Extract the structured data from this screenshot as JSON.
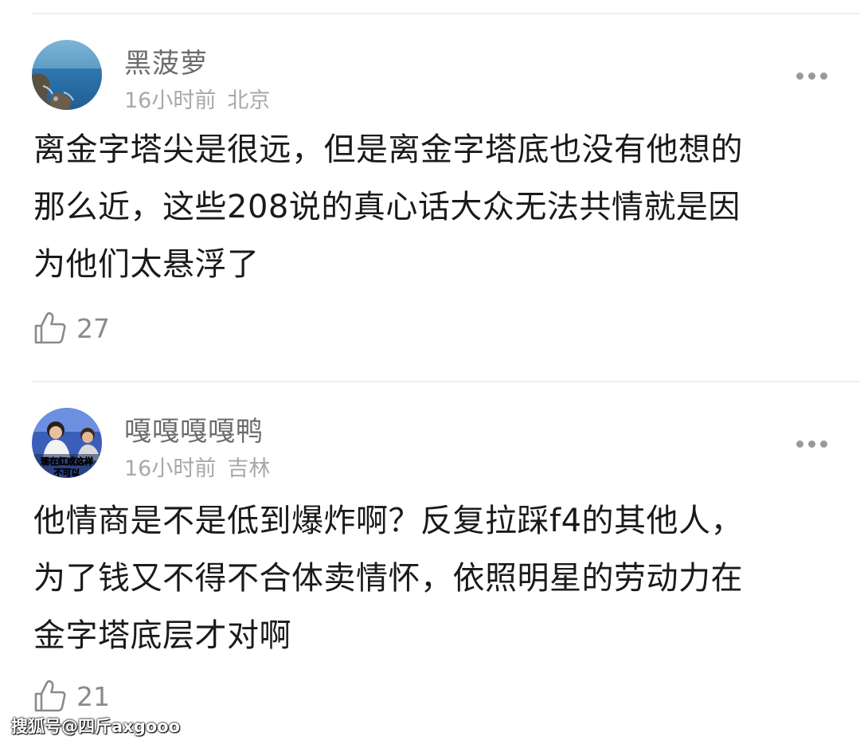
{
  "comments": [
    {
      "username": "黑菠萝",
      "time": "16小时前",
      "location": "北京",
      "avatar_icon": "sea-coast-photo",
      "content_lines": [
        "离金字塔尖是很远，但是离金字塔底也没有他想的",
        "那么近，这些208说的真心话大众无法共情就是因",
        "为他们太悬浮了"
      ],
      "likes": "27"
    },
    {
      "username": "嘎嘎嘎嘎鸭",
      "time": "16小时前",
      "location": "吉林",
      "avatar_icon": "tv-show-screenshot",
      "avatar_caption": "现在红成这样 不可以",
      "content_lines": [
        "他情商是不是低到爆炸啊？反复拉踩f4的其他人，",
        "为了钱又不得不合体卖情怀，依照明星的劳动力在",
        "金字塔底层才对啊"
      ],
      "likes": "21"
    }
  ],
  "watermark": "搜狐号@四斤axgooo",
  "colors": {
    "username": "#6b6b6b",
    "meta": "#a8a8a8",
    "content": "#1a1a1a",
    "divider": "#eeeeee"
  }
}
